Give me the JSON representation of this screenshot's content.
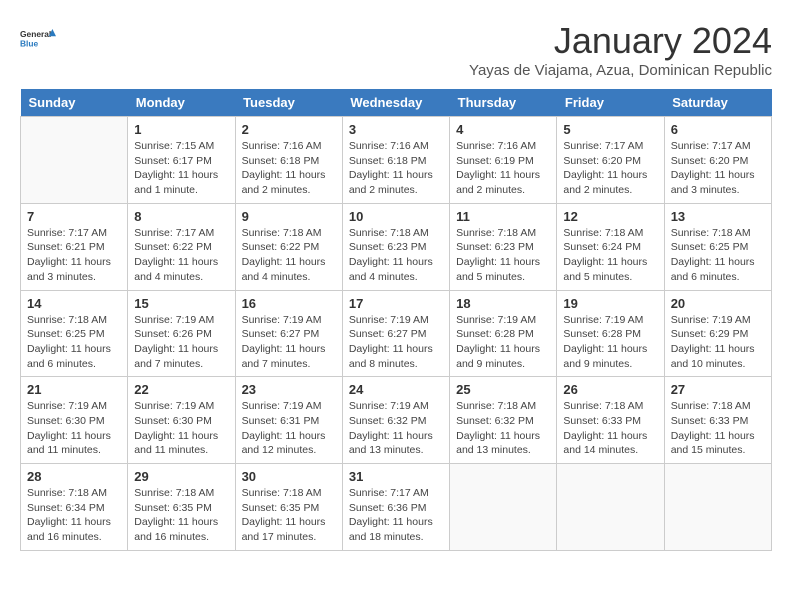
{
  "header": {
    "logo_general": "General",
    "logo_blue": "Blue",
    "month_title": "January 2024",
    "subtitle": "Yayas de Viajama, Azua, Dominican Republic"
  },
  "days_of_week": [
    "Sunday",
    "Monday",
    "Tuesday",
    "Wednesday",
    "Thursday",
    "Friday",
    "Saturday"
  ],
  "weeks": [
    [
      {
        "day": "",
        "info": ""
      },
      {
        "day": "1",
        "info": "Sunrise: 7:15 AM\nSunset: 6:17 PM\nDaylight: 11 hours\nand 1 minute."
      },
      {
        "day": "2",
        "info": "Sunrise: 7:16 AM\nSunset: 6:18 PM\nDaylight: 11 hours\nand 2 minutes."
      },
      {
        "day": "3",
        "info": "Sunrise: 7:16 AM\nSunset: 6:18 PM\nDaylight: 11 hours\nand 2 minutes."
      },
      {
        "day": "4",
        "info": "Sunrise: 7:16 AM\nSunset: 6:19 PM\nDaylight: 11 hours\nand 2 minutes."
      },
      {
        "day": "5",
        "info": "Sunrise: 7:17 AM\nSunset: 6:20 PM\nDaylight: 11 hours\nand 2 minutes."
      },
      {
        "day": "6",
        "info": "Sunrise: 7:17 AM\nSunset: 6:20 PM\nDaylight: 11 hours\nand 3 minutes."
      }
    ],
    [
      {
        "day": "7",
        "info": "Sunrise: 7:17 AM\nSunset: 6:21 PM\nDaylight: 11 hours\nand 3 minutes."
      },
      {
        "day": "8",
        "info": "Sunrise: 7:17 AM\nSunset: 6:22 PM\nDaylight: 11 hours\nand 4 minutes."
      },
      {
        "day": "9",
        "info": "Sunrise: 7:18 AM\nSunset: 6:22 PM\nDaylight: 11 hours\nand 4 minutes."
      },
      {
        "day": "10",
        "info": "Sunrise: 7:18 AM\nSunset: 6:23 PM\nDaylight: 11 hours\nand 4 minutes."
      },
      {
        "day": "11",
        "info": "Sunrise: 7:18 AM\nSunset: 6:23 PM\nDaylight: 11 hours\nand 5 minutes."
      },
      {
        "day": "12",
        "info": "Sunrise: 7:18 AM\nSunset: 6:24 PM\nDaylight: 11 hours\nand 5 minutes."
      },
      {
        "day": "13",
        "info": "Sunrise: 7:18 AM\nSunset: 6:25 PM\nDaylight: 11 hours\nand 6 minutes."
      }
    ],
    [
      {
        "day": "14",
        "info": "Sunrise: 7:18 AM\nSunset: 6:25 PM\nDaylight: 11 hours\nand 6 minutes."
      },
      {
        "day": "15",
        "info": "Sunrise: 7:19 AM\nSunset: 6:26 PM\nDaylight: 11 hours\nand 7 minutes."
      },
      {
        "day": "16",
        "info": "Sunrise: 7:19 AM\nSunset: 6:27 PM\nDaylight: 11 hours\nand 7 minutes."
      },
      {
        "day": "17",
        "info": "Sunrise: 7:19 AM\nSunset: 6:27 PM\nDaylight: 11 hours\nand 8 minutes."
      },
      {
        "day": "18",
        "info": "Sunrise: 7:19 AM\nSunset: 6:28 PM\nDaylight: 11 hours\nand 9 minutes."
      },
      {
        "day": "19",
        "info": "Sunrise: 7:19 AM\nSunset: 6:28 PM\nDaylight: 11 hours\nand 9 minutes."
      },
      {
        "day": "20",
        "info": "Sunrise: 7:19 AM\nSunset: 6:29 PM\nDaylight: 11 hours\nand 10 minutes."
      }
    ],
    [
      {
        "day": "21",
        "info": "Sunrise: 7:19 AM\nSunset: 6:30 PM\nDaylight: 11 hours\nand 11 minutes."
      },
      {
        "day": "22",
        "info": "Sunrise: 7:19 AM\nSunset: 6:30 PM\nDaylight: 11 hours\nand 11 minutes."
      },
      {
        "day": "23",
        "info": "Sunrise: 7:19 AM\nSunset: 6:31 PM\nDaylight: 11 hours\nand 12 minutes."
      },
      {
        "day": "24",
        "info": "Sunrise: 7:19 AM\nSunset: 6:32 PM\nDaylight: 11 hours\nand 13 minutes."
      },
      {
        "day": "25",
        "info": "Sunrise: 7:18 AM\nSunset: 6:32 PM\nDaylight: 11 hours\nand 13 minutes."
      },
      {
        "day": "26",
        "info": "Sunrise: 7:18 AM\nSunset: 6:33 PM\nDaylight: 11 hours\nand 14 minutes."
      },
      {
        "day": "27",
        "info": "Sunrise: 7:18 AM\nSunset: 6:33 PM\nDaylight: 11 hours\nand 15 minutes."
      }
    ],
    [
      {
        "day": "28",
        "info": "Sunrise: 7:18 AM\nSunset: 6:34 PM\nDaylight: 11 hours\nand 16 minutes."
      },
      {
        "day": "29",
        "info": "Sunrise: 7:18 AM\nSunset: 6:35 PM\nDaylight: 11 hours\nand 16 minutes."
      },
      {
        "day": "30",
        "info": "Sunrise: 7:18 AM\nSunset: 6:35 PM\nDaylight: 11 hours\nand 17 minutes."
      },
      {
        "day": "31",
        "info": "Sunrise: 7:17 AM\nSunset: 6:36 PM\nDaylight: 11 hours\nand 18 minutes."
      },
      {
        "day": "",
        "info": ""
      },
      {
        "day": "",
        "info": ""
      },
      {
        "day": "",
        "info": ""
      }
    ]
  ]
}
